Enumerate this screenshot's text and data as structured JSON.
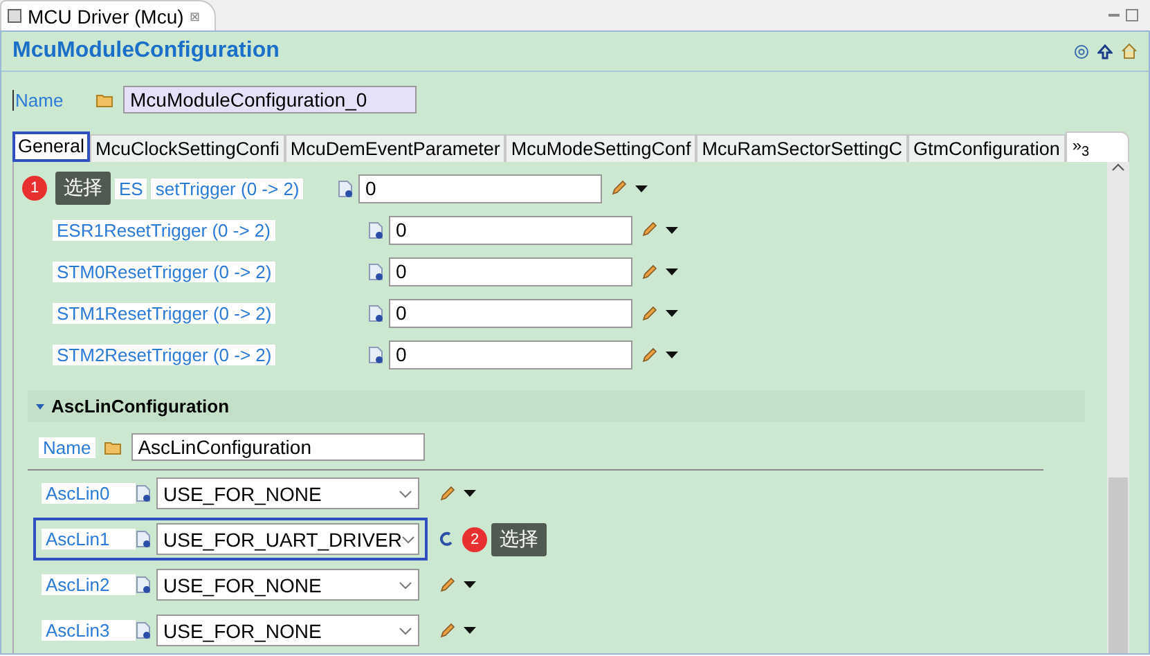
{
  "editor_tab": {
    "title": "MCU Driver (Mcu)",
    "close": "⊠"
  },
  "header": {
    "title": "McuModuleConfiguration"
  },
  "name_field": {
    "label": "Name",
    "value": "McuModuleConfiguration_0"
  },
  "tabs": [
    {
      "label": "General",
      "selected": true,
      "highlighted": true,
      "callout": {
        "number": "1",
        "text": "选择"
      }
    },
    {
      "label": "McuClockSettingConfi",
      "selected": false,
      "highlighted": false
    },
    {
      "label": "McuDemEventParameter",
      "selected": false,
      "highlighted": false
    },
    {
      "label": "McuModeSettingConf",
      "selected": false,
      "highlighted": false
    },
    {
      "label": "McuRamSectorSettingC",
      "selected": false,
      "highlighted": false
    },
    {
      "label": "GtmConfiguration",
      "selected": false,
      "highlighted": false
    }
  ],
  "tab_overflow": "»$_{3}$",
  "parameters": [
    {
      "label_parts": [
        "ES",
        "setTrigger (0 -> 2)"
      ],
      "value": "0"
    },
    {
      "label_parts": [
        "ESR1ResetTrigger (0 -> 2)"
      ],
      "value": "0"
    },
    {
      "label_parts": [
        "STM0ResetTrigger (0 -> 2)"
      ],
      "value": "0"
    },
    {
      "label_parts": [
        "STM1ResetTrigger (0 -> 2)"
      ],
      "value": "0"
    },
    {
      "label_parts": [
        "STM2ResetTrigger (0 -> 2)"
      ],
      "value": "0"
    }
  ],
  "section": {
    "title": "AscLinConfiguration",
    "expanded": true,
    "name_label": "Name",
    "name_value": "AscLinConfiguration",
    "rows": [
      {
        "label": "AscLin0",
        "value": "USE_FOR_NONE",
        "highlighted": false,
        "modified": false
      },
      {
        "label": "AscLin1",
        "value": "USE_FOR_UART_DRIVER",
        "highlighted": true,
        "modified": true,
        "callout": {
          "number": "2",
          "text": "选择"
        }
      },
      {
        "label": "AscLin2",
        "value": "USE_FOR_NONE",
        "highlighted": false,
        "modified": false
      },
      {
        "label": "AscLin3",
        "value": "USE_FOR_NONE",
        "highlighted": false,
        "modified": false
      }
    ]
  }
}
